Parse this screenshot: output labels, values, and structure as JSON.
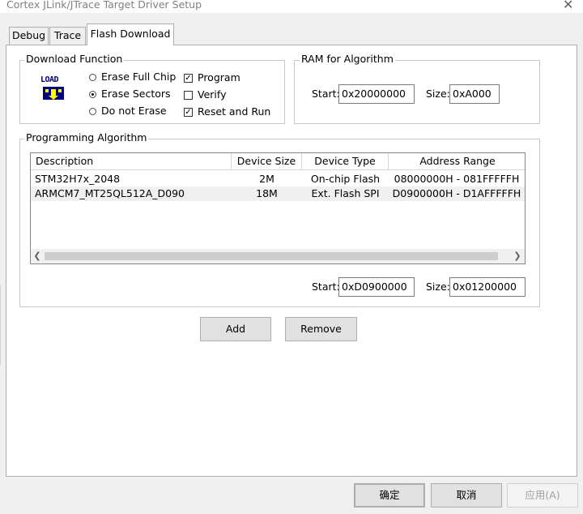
{
  "window": {
    "title": "Cortex JLink/JTrace Target Driver Setup",
    "close_glyph": "✕"
  },
  "tabs": [
    {
      "label": "Debug"
    },
    {
      "label": "Trace"
    },
    {
      "label": "Flash Download",
      "active": true
    }
  ],
  "download_function": {
    "title": "Download Function",
    "icon_text": "LOAD",
    "radios": [
      {
        "label": "Erase Full Chip",
        "selected": false
      },
      {
        "label": "Erase Sectors",
        "selected": true
      },
      {
        "label": "Do not Erase",
        "selected": false
      }
    ],
    "checks": [
      {
        "label": "Program",
        "checked": true
      },
      {
        "label": "Verify",
        "checked": false
      },
      {
        "label": "Reset and Run",
        "checked": true
      }
    ]
  },
  "ram": {
    "title": "RAM for Algorithm",
    "start_label": "Start:",
    "start_value": "0x20000000",
    "size_label": "Size:",
    "size_value": "0xA000"
  },
  "programming": {
    "title": "Programming Algorithm",
    "columns": [
      "Description",
      "Device Size",
      "Device Type",
      "Address Range"
    ],
    "rows": [
      [
        "STM32H7x_2048",
        "2M",
        "On-chip Flash",
        "08000000H - 081FFFFFH"
      ],
      [
        "ARMCM7_MT25QL512A_D090",
        "18M",
        "Ext. Flash SPI",
        "D0900000H - D1AFFFFFH"
      ]
    ],
    "start_label": "Start:",
    "start_value": "0xD0900000",
    "size_label": "Size:",
    "size_value": "0x01200000",
    "add_label": "Add",
    "remove_label": "Remove"
  },
  "footer": {
    "ok_label": "确定",
    "cancel_label": "取消",
    "apply_label": "应用(A)"
  },
  "colors": {
    "window_bg": "#f0f0f0",
    "panel_bg": "#ffffff",
    "border": "#adadad"
  }
}
